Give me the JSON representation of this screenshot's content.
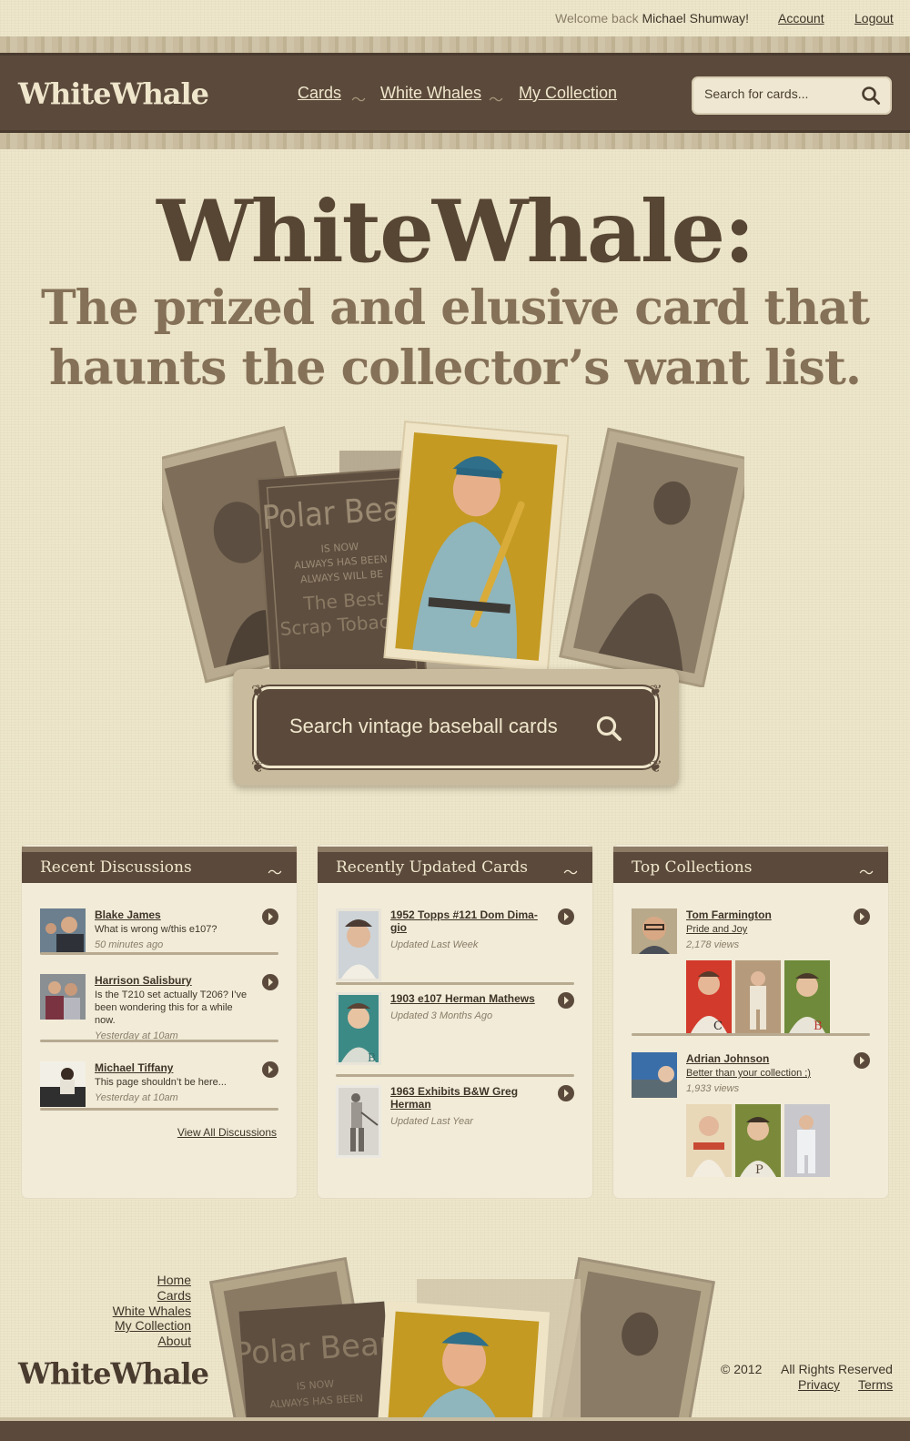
{
  "topbar": {
    "welcome_prefix": "Welcome back",
    "user_name": "Michael Shumway!",
    "account": "Account",
    "logout": "Logout"
  },
  "header": {
    "logo": "WhiteWhale",
    "nav": [
      "Cards",
      "White Whales",
      "My Collection"
    ],
    "search_placeholder": "Search for cards..."
  },
  "hero": {
    "title": "WhiteWhale:",
    "subtitle_line1": "The prized and elusive card that",
    "subtitle_line2": "haunts the collector’s want list.",
    "search_label": "Search vintage baseball cards",
    "card_texts": {
      "polar": "Polar Bear",
      "is_now": "IS NOW",
      "always_has": "ALWAYS HAS BEEN",
      "always_will": "ALWAYS WILL BE",
      "the_best": "The Best",
      "scrap": "Scrap Tobacco"
    }
  },
  "panels": {
    "discussions": {
      "title": "Recent Discussions",
      "items": [
        {
          "name": "Blake James",
          "text": "What is wrong w/this e107?",
          "time": "50 minutes ago"
        },
        {
          "name": "Harrison Salisbury",
          "text": "Is the T210 set actually T206? I’ve been wondering this for a while now.",
          "time": "Yesterday at 10am"
        },
        {
          "name": "Michael Tiffany",
          "text": "This page shouldn’t be here...",
          "time": "Yesterday at 10am"
        }
      ],
      "view_all": "View All Discussions"
    },
    "cards": {
      "title": "Recently Updated Cards",
      "items": [
        {
          "name": "1952 Topps #121 Dom Dima-gio",
          "updated": "Updated Last Week"
        },
        {
          "name": "1903 e107 Herman Mathews",
          "updated": "Updated 3 Months Ago"
        },
        {
          "name": "1963 Exhibits B&W Greg Herman",
          "updated": "Updated Last Year"
        }
      ]
    },
    "collections": {
      "title": "Top Collections",
      "items": [
        {
          "name": "Tom Farmington",
          "collection": "Pride and Joy",
          "views": "2,178 views"
        },
        {
          "name": "Adrian Johnson",
          "collection": "Better than your collection ;)",
          "views": "1,933 views"
        }
      ]
    }
  },
  "footer": {
    "links": [
      "Home",
      "Cards",
      "White Whales",
      "My Collection",
      "About"
    ],
    "logo": "WhiteWhale",
    "copyright": "© 2012",
    "rights": "All Rights Reserved",
    "privacy": "Privacy",
    "terms": "Terms"
  },
  "colors": {
    "paper": "#ede6cb",
    "brown": "#5b4a3b",
    "cream": "#efe6cc",
    "gold_card": "#c49a22"
  },
  "icons": [
    "search-icon",
    "arrow-right-icon",
    "swirl-ornament-icon",
    "tilde-ornament-icon"
  ]
}
